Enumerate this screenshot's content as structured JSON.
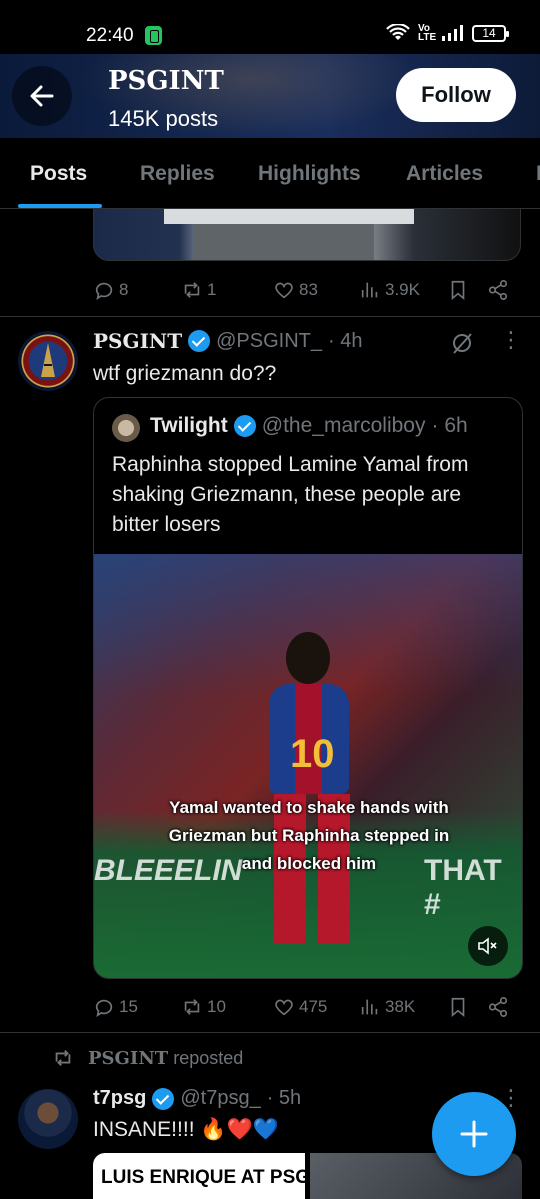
{
  "status_bar": {
    "time": "22:40",
    "network": "Vo LTE",
    "battery": "14"
  },
  "header": {
    "title": "PSGINT",
    "posts_count": "145K posts",
    "follow_label": "Follow"
  },
  "tabs": [
    {
      "label": "Posts",
      "active": true
    },
    {
      "label": "Replies"
    },
    {
      "label": "Highlights"
    },
    {
      "label": "Articles"
    },
    {
      "label": "M"
    }
  ],
  "previous_post": {
    "actions": {
      "replies": "8",
      "reposts": "1",
      "likes": "83",
      "views": "3.9K"
    }
  },
  "post": {
    "name": "PSGINT",
    "handle": "@PSGINT_",
    "time": "· 4h",
    "text": "wtf griezmann do??",
    "quote": {
      "name": "Twilight",
      "handle": "@the_marcoliboy",
      "time": "· 6h",
      "text": "Raphinha stopped Lamine Yamal from shaking Griezmann, these people are bitter losers",
      "media_caption": "Yamal wanted to shake hands with Griezman but Raphinha stepped in and blocked him",
      "banner_left": "BLEEELIN",
      "banner_right": "THAT #"
    },
    "actions": {
      "replies": "15",
      "reposts": "10",
      "likes": "475",
      "views": "38K"
    }
  },
  "repost": {
    "label": "reposted",
    "reposter": "PSGINT",
    "name": "t7psg",
    "handle": "@t7psg_",
    "time": "· 5h",
    "text": "INSANE!!!! 🔥❤️💙",
    "card_text": "LUIS ENRIQUE AT PSG"
  },
  "colors": {
    "accent": "#1d9bf0",
    "muted": "#71767b",
    "border": "#2f3336"
  }
}
